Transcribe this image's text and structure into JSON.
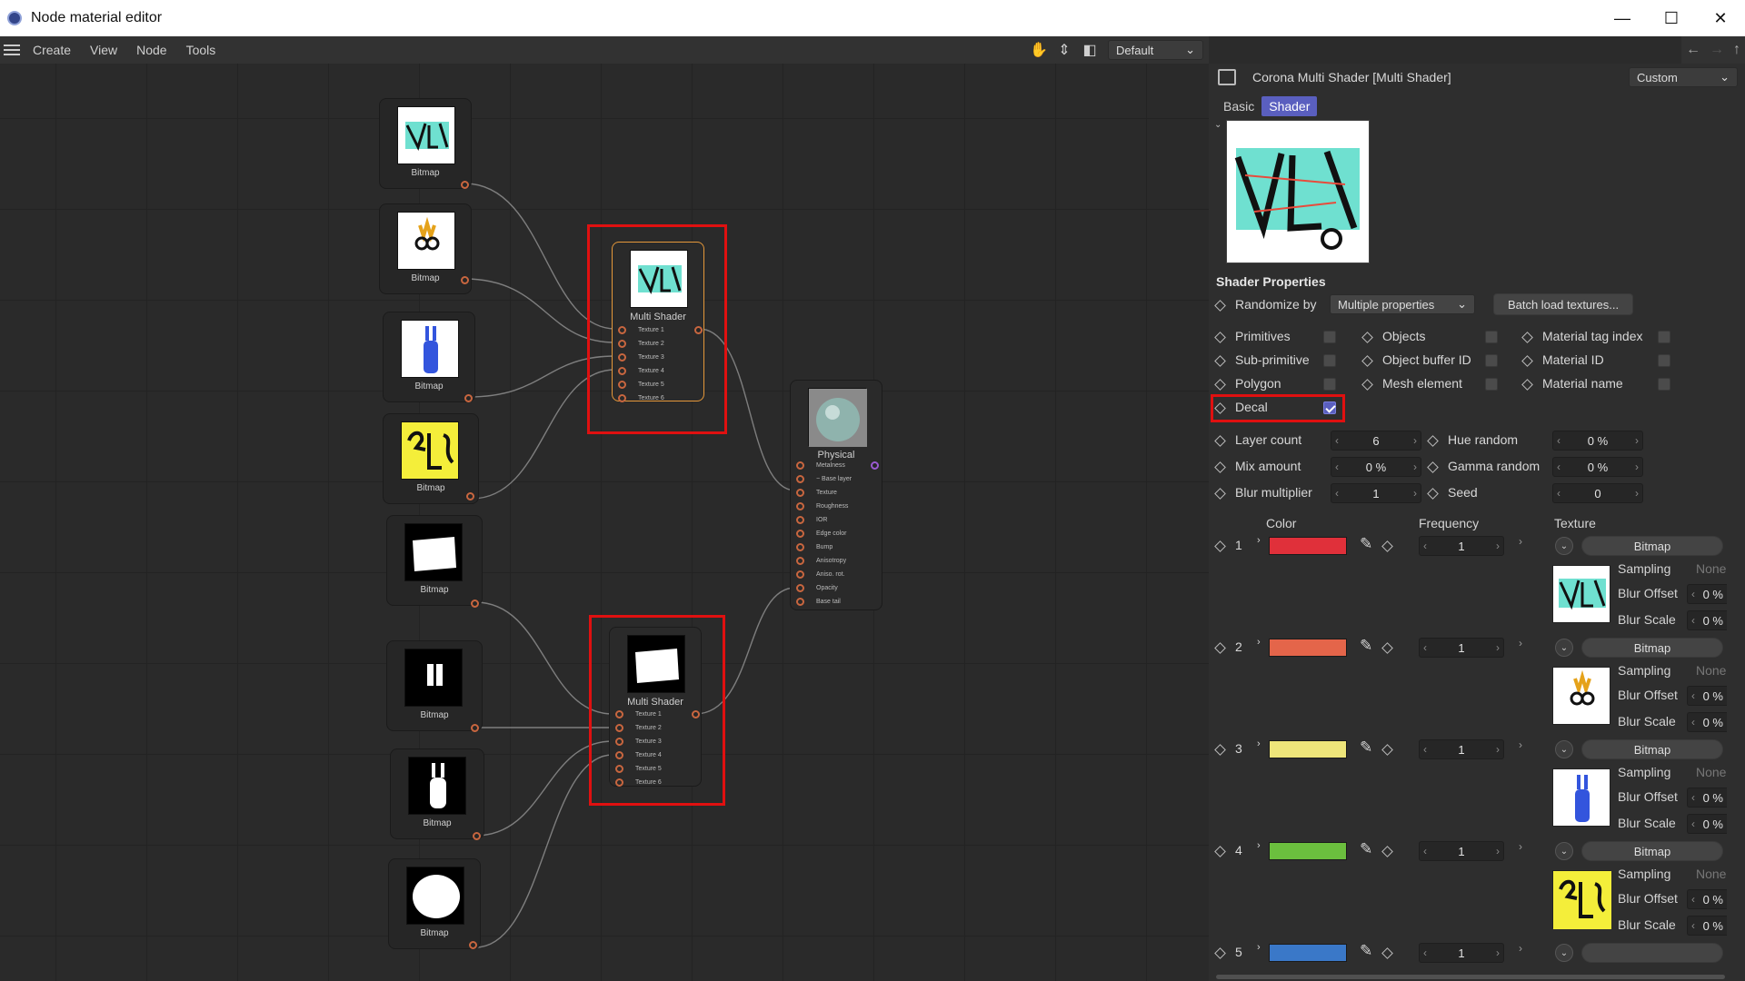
{
  "window": {
    "title": "Node material editor",
    "controls": [
      "—",
      "☐",
      "✕"
    ]
  },
  "menu": {
    "items": [
      "Create",
      "View",
      "Node",
      "Tools"
    ],
    "layout_value": "Default"
  },
  "canvas": {
    "bitmap_label": "Bitmap",
    "multi_shader_label": "Multi Shader",
    "multi_shader_ports": [
      "Texture 1",
      "Texture 2",
      "Texture 3",
      "Texture 4",
      "Texture 5",
      "Texture 6"
    ],
    "physical_label": "Physical",
    "physical_ports": [
      "Metalness",
      "− Base layer",
      "Texture",
      "Roughness",
      "IOR",
      "Edge color",
      "Bump",
      "Anisotropy",
      "Aniso. rot.",
      "Opacity",
      "Base tail"
    ]
  },
  "panel": {
    "title": "Corona Multi Shader [Multi Shader]",
    "preset": "Custom",
    "tabs": [
      "Basic",
      "Shader"
    ],
    "active_tab": "Shader",
    "section": "Shader Properties",
    "randomize_label": "Randomize by",
    "randomize_value": "Multiple properties",
    "batch_button": "Batch load textures...",
    "checkboxes": {
      "primitives": "Primitives",
      "sub_primitive": "Sub-primitive",
      "polygon": "Polygon",
      "decal": "Decal",
      "objects": "Objects",
      "object_buffer_id": "Object buffer ID",
      "mesh_element": "Mesh element",
      "material_tag_index": "Material tag index",
      "material_id": "Material ID",
      "material_name": "Material name"
    },
    "decal_checked": true,
    "params": {
      "layer_count_label": "Layer count",
      "layer_count": "6",
      "mix_amount_label": "Mix amount",
      "mix_amount": "0 %",
      "blur_multiplier_label": "Blur multiplier",
      "blur_multiplier": "1",
      "hue_random_label": "Hue random",
      "hue_random": "0 %",
      "gamma_random_label": "Gamma random",
      "gamma_random": "0 %",
      "seed_label": "Seed",
      "seed": "0"
    },
    "columns": {
      "color": "Color",
      "frequency": "Frequency",
      "texture": "Texture"
    },
    "sub_labels": {
      "sampling": "Sampling",
      "sampling_value": "None",
      "blur_offset": "Blur Offset",
      "blur_scale": "Blur Scale",
      "pct": "0 %"
    },
    "layers": [
      {
        "index": "1",
        "color": "#e0303a",
        "frequency": "1",
        "texture": "Bitmap"
      },
      {
        "index": "2",
        "color": "#e4654a",
        "frequency": "1",
        "texture": "Bitmap"
      },
      {
        "index": "3",
        "color": "#eee57a",
        "frequency": "1",
        "texture": "Bitmap"
      },
      {
        "index": "4",
        "color": "#6bbf3e",
        "frequency": "1",
        "texture": "Bitmap"
      },
      {
        "index": "5",
        "color": "#3a78c8",
        "frequency": "1",
        "texture": ""
      }
    ]
  },
  "colors": {
    "accent": "#5a5fbf",
    "port": "#c8663f",
    "highlight_box": "#e01010",
    "selected_node": "#e5983a"
  }
}
